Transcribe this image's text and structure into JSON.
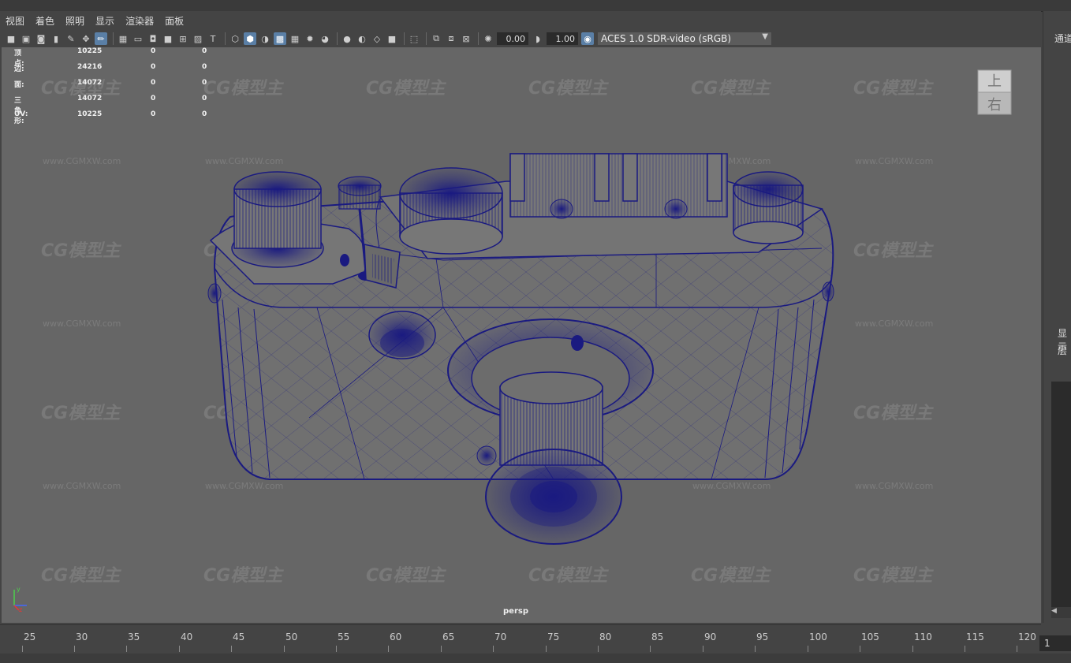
{
  "menu": [
    "视图",
    "着色",
    "照明",
    "显示",
    "渲染器",
    "面板"
  ],
  "toolbar": {
    "field1": "0.00",
    "field2": "1.00",
    "colorspace": "ACES 1.0 SDR-video (sRGB)",
    "icons": [
      "camera-icon",
      "camera-attr-icon",
      "bookmark-icon",
      "image-plane-icon",
      "grid-icon",
      "film-gate-icon",
      "resolution-gate-icon",
      "wireframe-icon",
      "smooth-shade-icon",
      "textured-icon",
      "lights-icon",
      "shadows-icon",
      "isolate-icon",
      "xray-icon",
      "exposure-icon",
      "gamma-icon",
      "color-management-icon"
    ]
  },
  "hud": {
    "rows": [
      {
        "label": "顶点:",
        "v1": "10225",
        "v2": "0",
        "v3": "0"
      },
      {
        "label": "边:",
        "v1": "24216",
        "v2": "0",
        "v3": "0"
      },
      {
        "label": "面:",
        "v1": "14072",
        "v2": "0",
        "v3": "0"
      },
      {
        "label": "三角形:",
        "v1": "14072",
        "v2": "0",
        "v3": "0"
      },
      {
        "label": "UV:",
        "v1": "10225",
        "v2": "0",
        "v3": "0"
      }
    ]
  },
  "viewcube": {
    "top": "上",
    "right": "右"
  },
  "camera_name": "persp",
  "watermark": {
    "logo": "CG模型主",
    "url": "www.CGMXW.com"
  },
  "right_panel": {
    "title": "通道",
    "display": "显示",
    "layer": "层"
  },
  "timeline": {
    "ticks": [
      "25",
      "30",
      "35",
      "40",
      "45",
      "50",
      "55",
      "60",
      "65",
      "70",
      "75",
      "80",
      "85",
      "90",
      "95",
      "100",
      "105",
      "110",
      "115",
      "120"
    ],
    "current_frame": "1"
  },
  "colors": {
    "wire": "#1a1a80",
    "viewport_bg": "#666666",
    "ui_bg": "#444444"
  }
}
